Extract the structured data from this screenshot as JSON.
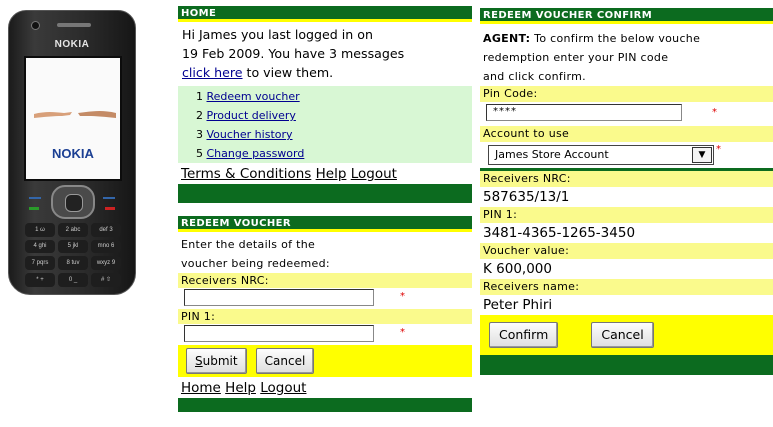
{
  "phone": {
    "brand": "NOKIA",
    "screen_brand": "NOKIA",
    "keys": [
      "1 ω",
      "2 abc",
      "def 3",
      "4 ghi",
      "5 jkl",
      "mno 6",
      "7 pqrs",
      "8 tuv",
      "wxyz 9",
      "* +",
      "0 _",
      "# ⇧"
    ]
  },
  "home": {
    "header": "HOME",
    "message_line1": "Hi James you last logged in on",
    "message_line2": "19 Feb 2009. You have 3 messages",
    "click_here": "click here",
    "to_view": " to view them.",
    "menu": [
      {
        "num": "1",
        "label": "Redeem voucher"
      },
      {
        "num": "2",
        "label": "Product delivery"
      },
      {
        "num": "3",
        "label": "Voucher history"
      },
      {
        "num": "5",
        "label": "Change password"
      }
    ],
    "footer": {
      "terms": "Terms & Conditions",
      "help": "Help",
      "logout": "Logout"
    }
  },
  "redeem": {
    "header": "REDEEM VOUCHER",
    "intro_line1": "Enter the details of the",
    "intro_line2": "voucher being redeemed:",
    "nrc_label": "Receivers NRC:",
    "nrc_value": "",
    "pin_label": "PIN 1:",
    "pin_value": "",
    "required": "*",
    "submit": "Submit",
    "cancel": "Cancel",
    "footer": {
      "home": "Home",
      "help": "Help",
      "logout": "Logout"
    }
  },
  "confirm": {
    "header": "REDEEM VOUCHER CONFIRM",
    "agent_bold": "AGENT:",
    "agent_line1": " To confirm the below vouche",
    "agent_line2": "redemption enter your PIN code",
    "agent_line3": "and click confirm.",
    "pin_label": "Pin Code:",
    "pin_value": "****",
    "required": "*",
    "account_label": "Account to use",
    "account_value": "James Store Account",
    "receivers_nrc_label": "Receivers NRC:",
    "receivers_nrc_value": "587635/13/1",
    "pin1_label": "PIN 1:",
    "pin1_value": "3481-4365-1265-3450",
    "voucher_label": "Voucher value:",
    "voucher_value": "K 600,000",
    "name_label": "Receivers name:",
    "name_value": "Peter Phiri",
    "confirm_btn": "Confirm",
    "cancel_btn": "Cancel"
  },
  "colors": {
    "header_green": "#0c6b1f",
    "header_underline": "#ffff00",
    "label_yellow": "#fafa8c",
    "menu_green": "#d8f7d4",
    "brand_blue": "#1b3f93"
  }
}
